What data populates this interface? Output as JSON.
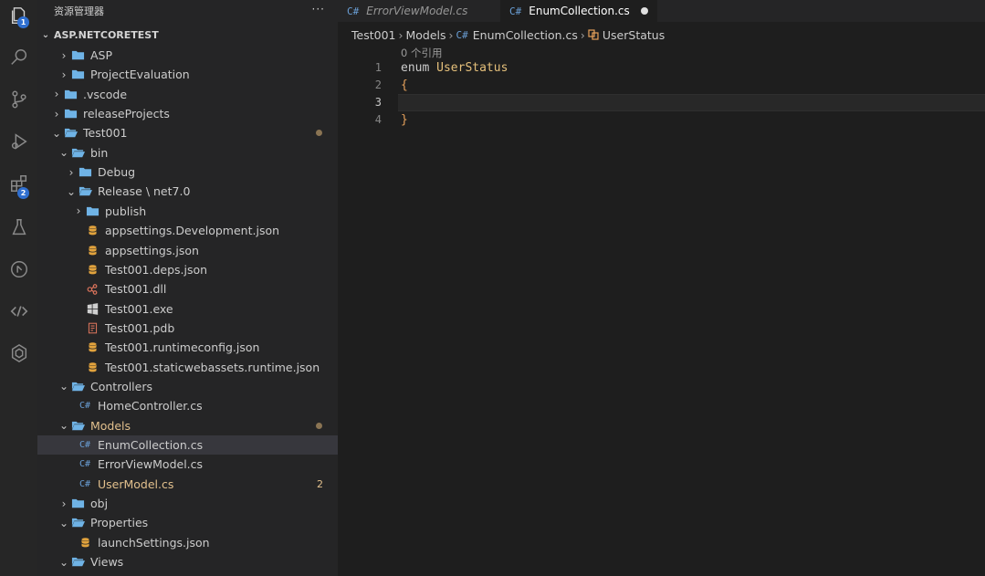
{
  "explorer": {
    "title": "资源管理器",
    "more": "···",
    "section": "ASP.NETCORETEST",
    "items": [
      {
        "label": "ASP",
        "twist": "›",
        "icon": "folder-icon",
        "depth": 2
      },
      {
        "label": "ProjectEvaluation",
        "twist": "›",
        "icon": "folder-icon",
        "depth": 2
      },
      {
        "label": ".vscode",
        "twist": "›",
        "icon": "folder-icon",
        "depth": 1
      },
      {
        "label": "releaseProjects",
        "twist": "›",
        "icon": "folder-icon",
        "depth": 1
      },
      {
        "label": "Test001",
        "twist": "⌄",
        "icon": "folder-open-icon",
        "depth": 1
      },
      {
        "label": "bin",
        "twist": "⌄",
        "icon": "folder-open-icon",
        "depth": 2
      },
      {
        "label": "Debug",
        "twist": "›",
        "icon": "folder-icon",
        "depth": 3
      },
      {
        "label": "Release \\ net7.0",
        "twist": "⌄",
        "icon": "folder-open-icon",
        "depth": 3
      },
      {
        "label": "publish",
        "twist": "›",
        "icon": "folder-icon",
        "depth": 4
      },
      {
        "label": "appsettings.Development.json",
        "icon": "json-icon",
        "depth": 4
      },
      {
        "label": "appsettings.json",
        "icon": "json-icon",
        "depth": 4
      },
      {
        "label": "Test001.deps.json",
        "icon": "json-icon",
        "depth": 4
      },
      {
        "label": "Test001.dll",
        "icon": "dll-icon",
        "depth": 4
      },
      {
        "label": "Test001.exe",
        "icon": "windows-icon",
        "depth": 4
      },
      {
        "label": "Test001.pdb",
        "icon": "pdb-icon",
        "depth": 4
      },
      {
        "label": "Test001.runtimeconfig.json",
        "icon": "json-icon",
        "depth": 4
      },
      {
        "label": "Test001.staticwebassets.runtime.json",
        "icon": "json-icon",
        "depth": 4
      },
      {
        "label": "Controllers",
        "twist": "⌄",
        "icon": "folder-open-icon",
        "depth": 2
      },
      {
        "label": "HomeController.cs",
        "icon": "csharp-icon",
        "depth": 3
      },
      {
        "label": "Models",
        "twist": "⌄",
        "icon": "folder-open-icon",
        "depth": 2,
        "modified": true
      },
      {
        "label": "EnumCollection.cs",
        "icon": "csharp-icon",
        "depth": 3,
        "selected": true
      },
      {
        "label": "ErrorViewModel.cs",
        "icon": "csharp-icon",
        "depth": 3
      },
      {
        "label": "UserModel.cs",
        "icon": "csharp-icon",
        "depth": 3,
        "modified": true,
        "badge": "2"
      },
      {
        "label": "obj",
        "twist": "›",
        "icon": "folder-icon",
        "depth": 2
      },
      {
        "label": "Properties",
        "twist": "⌄",
        "icon": "folder-open-icon",
        "depth": 2
      },
      {
        "label": "launchSettings.json",
        "icon": "json-icon",
        "depth": 3
      },
      {
        "label": "Views",
        "twist": "⌄",
        "icon": "folder-open-icon",
        "depth": 2
      }
    ]
  },
  "activity": {
    "explorer_badge": "1",
    "extensions_badge": "2"
  },
  "tabs": [
    {
      "prefix": "C#",
      "label": "ErrorViewModel.cs",
      "active": false
    },
    {
      "prefix": "C#",
      "label": "EnumCollection.cs",
      "active": true
    }
  ],
  "breadcrumb": {
    "parts": [
      "Test001",
      "Models",
      "EnumCollection.cs",
      "UserStatus"
    ],
    "file_prefix": "C#"
  },
  "editor": {
    "codelens": "0 个引用",
    "line_numbers": [
      "1",
      "2",
      "3",
      "4"
    ],
    "lines": [
      {
        "kw": "enum ",
        "ty": "UserStatus"
      },
      {
        "br": "{"
      },
      {
        "br": ""
      },
      {
        "br": "}"
      }
    ]
  },
  "colors": {
    "accent_badge": "#2f6fd0",
    "folder": "#6fb3e6",
    "json": "#e2a33d",
    "modified": "#e2c08d",
    "csharp": "#6a9fd6"
  }
}
